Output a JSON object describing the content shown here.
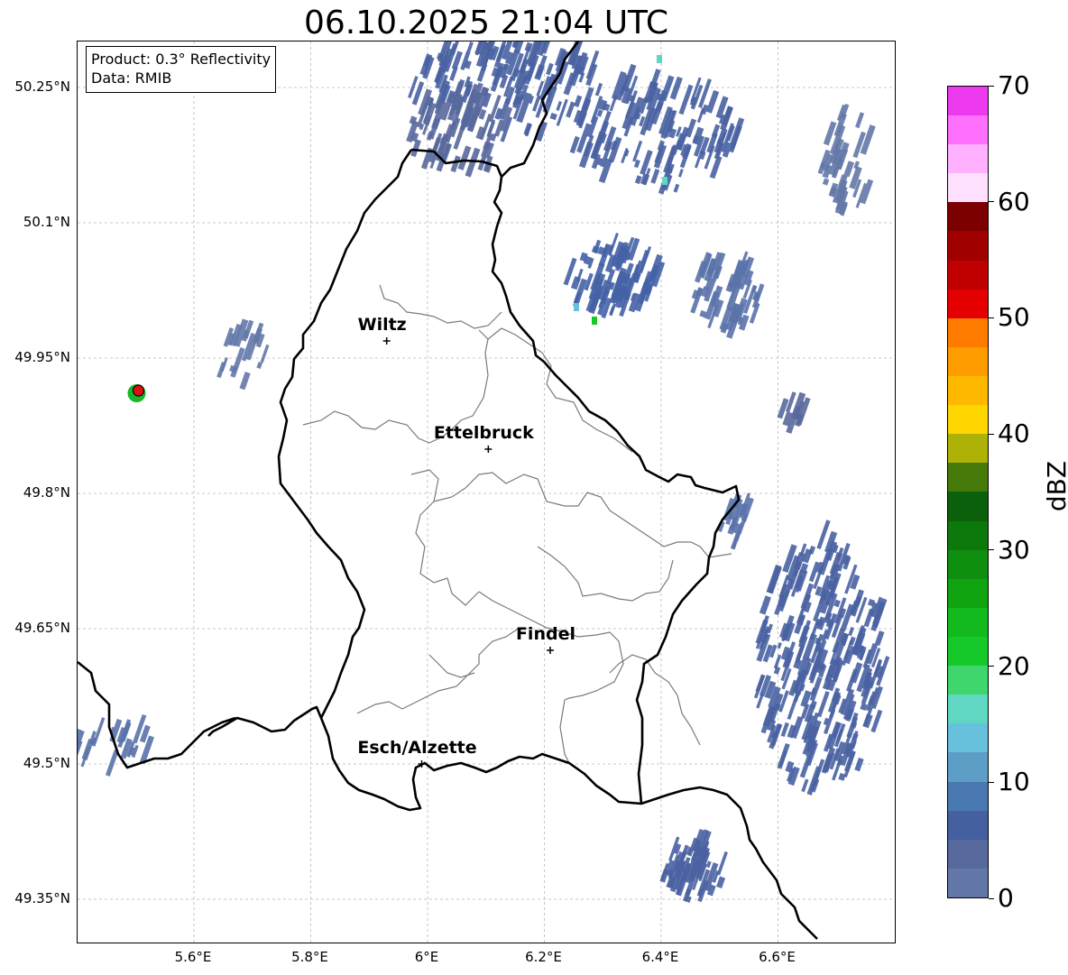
{
  "title": "06.10.2025 21:04 UTC",
  "info_box": {
    "product": "Product: 0.3° Reflectivity",
    "data": "Data: RMIB"
  },
  "lat_labels": [
    "50.25°N",
    "50.1°N",
    "49.95°N",
    "49.8°N",
    "49.65°N",
    "49.5°N",
    "49.35°N"
  ],
  "lon_labels": [
    "5.6°E",
    "5.8°E",
    "6°E",
    "6.2°E",
    "6.4°E",
    "6.6°E"
  ],
  "cities": [
    {
      "name": "Wiltz",
      "lon": 5.93,
      "lat": 49.969
    },
    {
      "name": "Ettelbruck",
      "lon": 6.104,
      "lat": 49.849
    },
    {
      "name": "Findel",
      "lon": 6.21,
      "lat": 49.626
    },
    {
      "name": "Esch/Alzette",
      "lon": 5.99,
      "lat": 49.5
    }
  ],
  "map_extent": {
    "lon": [
      5.4,
      6.8
    ],
    "lat": [
      49.3,
      50.3
    ]
  },
  "colorbar": {
    "label": "dBZ",
    "ticks": [
      "0",
      "10",
      "20",
      "30",
      "40",
      "50",
      "60",
      "70"
    ],
    "min": 0,
    "max": 70,
    "step": 2.5,
    "colors": [
      "#6378a8",
      "#58699d",
      "#44609f",
      "#4a78b1",
      "#5d9ec6",
      "#67c0dc",
      "#60d7c2",
      "#3ed66d",
      "#16c92a",
      "#13ba1d",
      "#11a411",
      "#0f8e0f",
      "#0d790d",
      "#0b600b",
      "#457a09",
      "#aeb206",
      "#ffd600",
      "#ffb800",
      "#ff9d00",
      "#ff7b00",
      "#e40000",
      "#c00000",
      "#a00000",
      "#7c0000",
      "#ffe0ff",
      "#ffb0ff",
      "#ff70ff",
      "#ee3aee"
    ]
  },
  "radar_site": {
    "lon": 5.505,
    "lat": 49.914,
    "color": "#e01010"
  }
}
